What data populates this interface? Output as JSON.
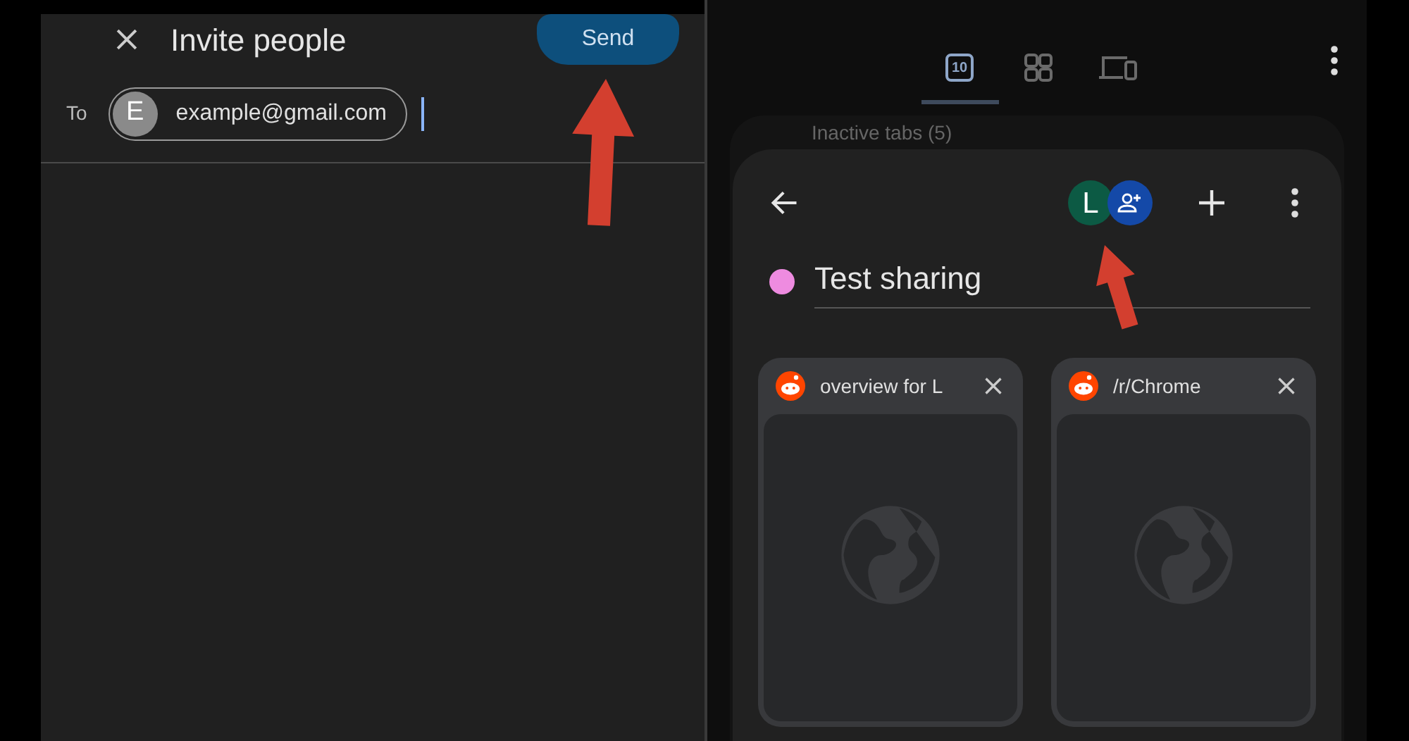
{
  "invite_dialog": {
    "title": "Invite people",
    "send_button": "Send",
    "to_label": "To",
    "recipients": [
      {
        "initial": "E",
        "email": "example@gmail.com"
      }
    ]
  },
  "tab_switcher": {
    "tabs": [
      {
        "kind": "count",
        "label": "10",
        "selected": true
      },
      {
        "kind": "grid",
        "selected": false
      },
      {
        "kind": "devices",
        "selected": false
      }
    ],
    "behind_label": "Inactive tabs (5)"
  },
  "group_sheet": {
    "member_initial": "L",
    "color": "#ee8be0",
    "title": "Test sharing",
    "tabs": [
      {
        "title": "overview for L"
      },
      {
        "title": "/r/Chrome"
      }
    ]
  }
}
